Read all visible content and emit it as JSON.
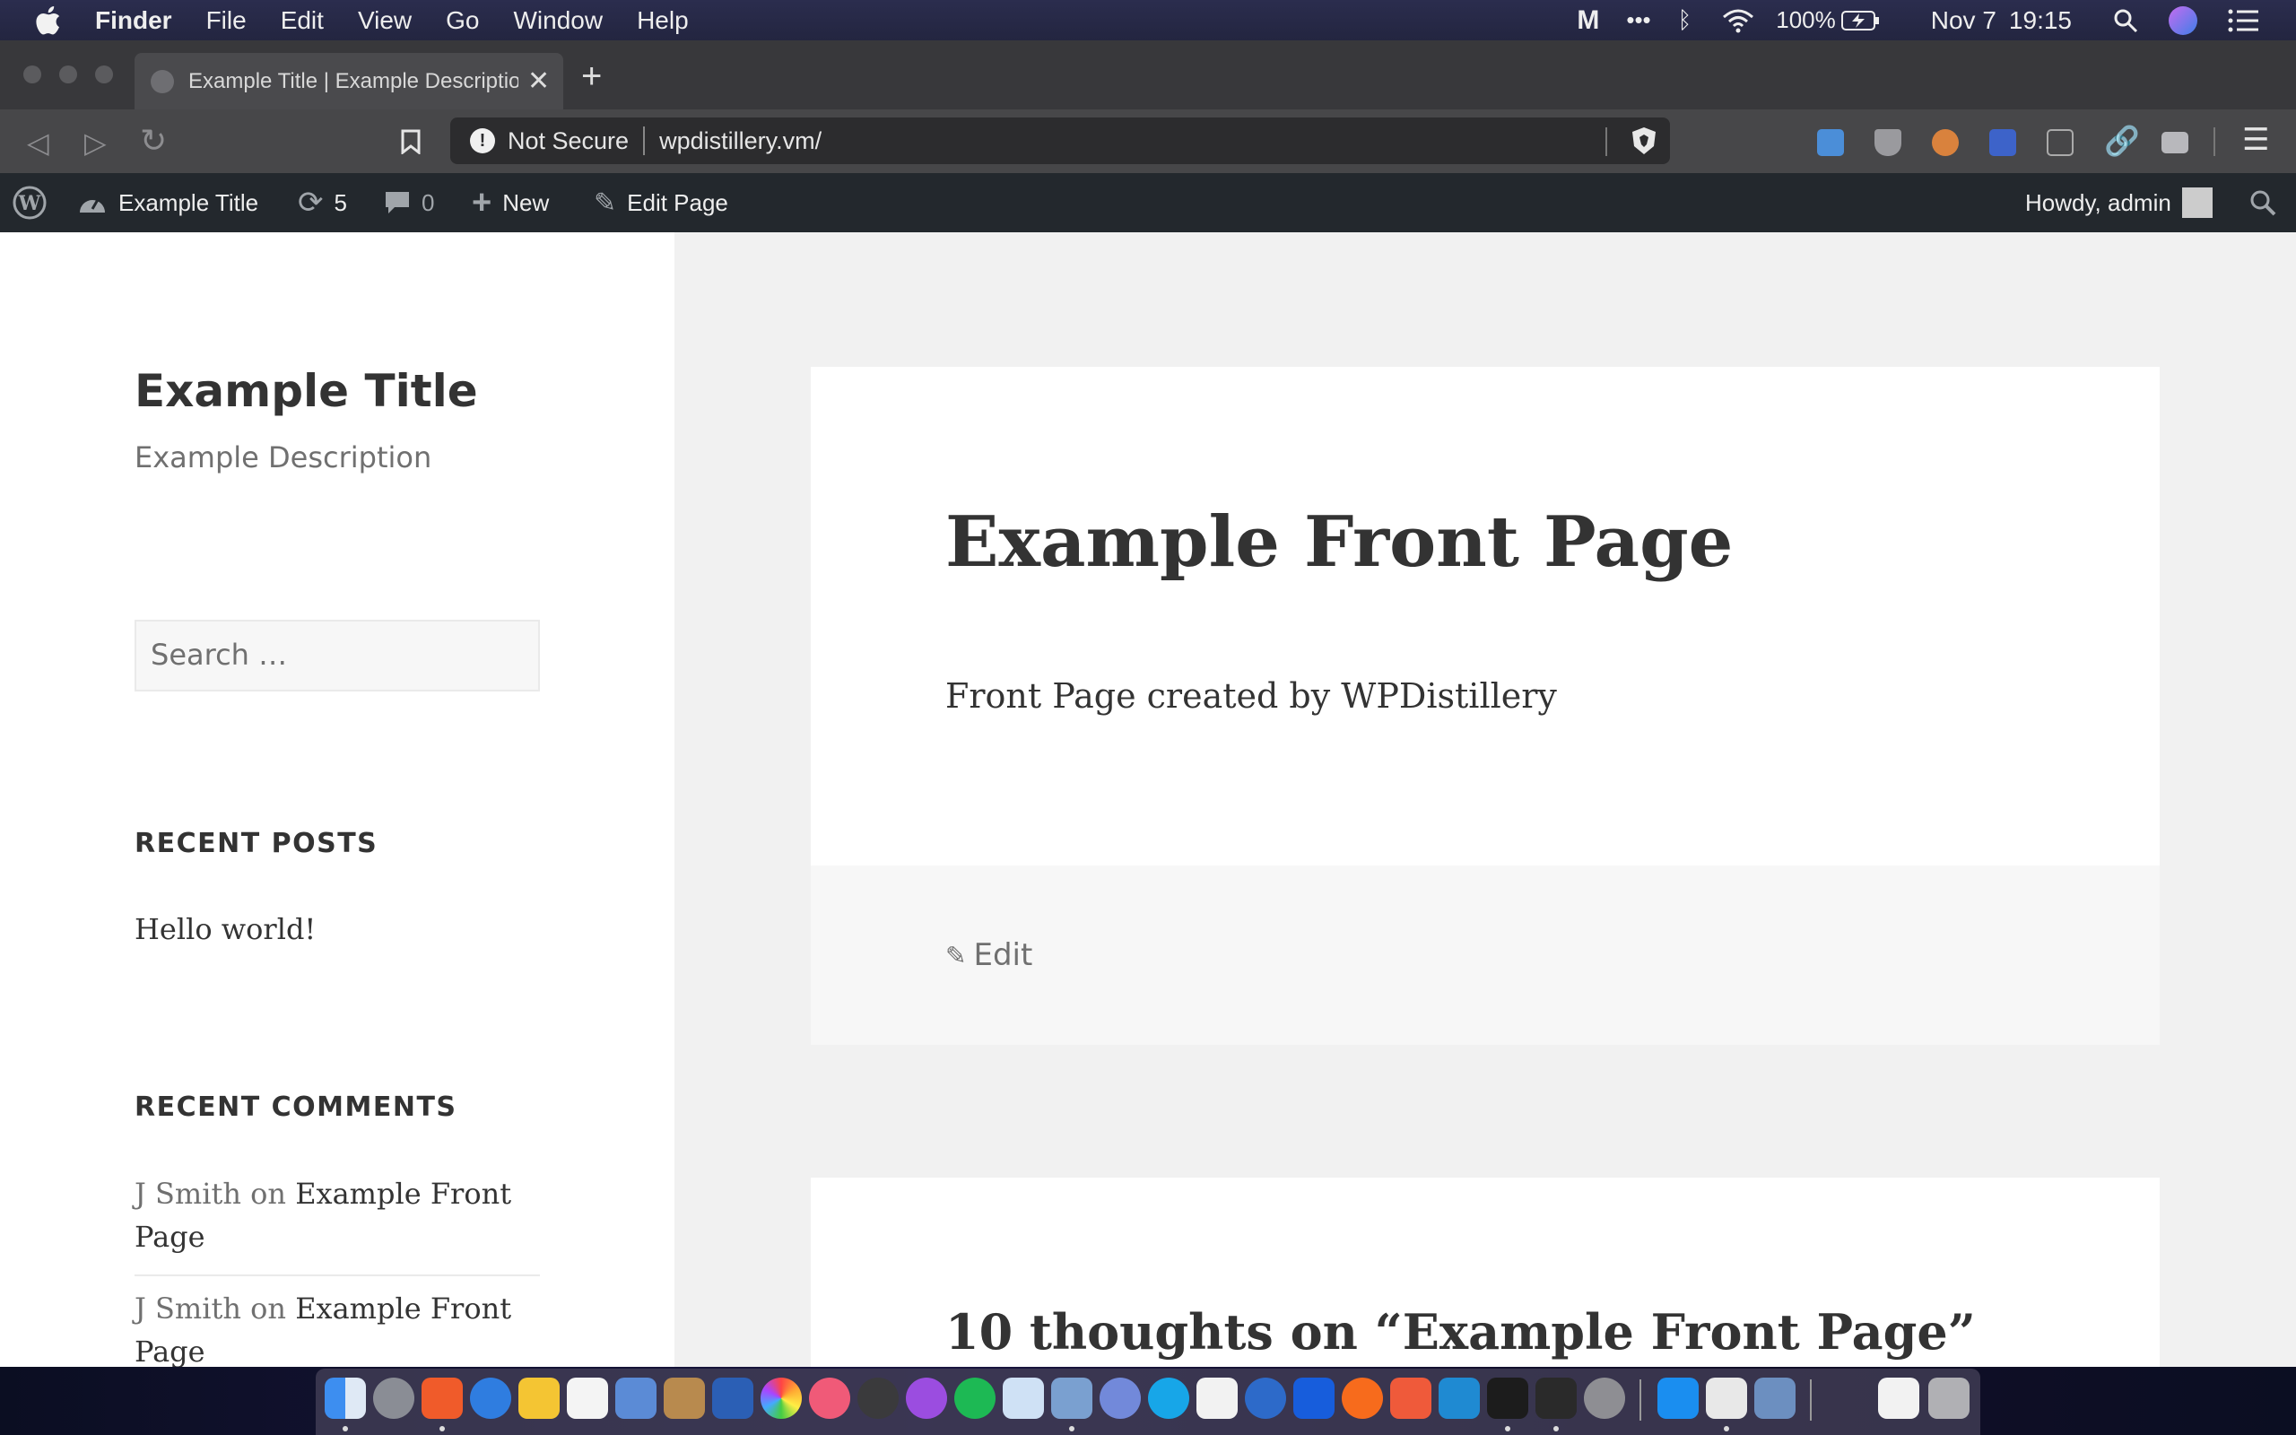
{
  "menubar": {
    "app": "Finder",
    "items": [
      "File",
      "Edit",
      "View",
      "Go",
      "Window",
      "Help"
    ],
    "battery": "100%",
    "date": "Nov 7",
    "time": "19:15"
  },
  "browser": {
    "tab_title": "Example Title | Example Description",
    "security": "Not Secure",
    "url": "wpdistillery.vm/"
  },
  "adminbar": {
    "site_name": "Example Title",
    "updates": "5",
    "comments": "0",
    "new": "New",
    "edit_page": "Edit Page",
    "howdy": "Howdy, admin"
  },
  "sidebar": {
    "site_title": "Example Title",
    "site_description": "Example Description",
    "search_placeholder": "Search …",
    "recent_posts_title": "RECENT POSTS",
    "recent_posts": [
      "Hello world!"
    ],
    "recent_comments_title": "RECENT COMMENTS",
    "recent_comments": [
      {
        "author": "J Smith",
        "on": "on",
        "post": "Example Front Page"
      },
      {
        "author": "J Smith",
        "on": "on",
        "post": "Example Front Page"
      }
    ]
  },
  "main": {
    "entry_title": "Example Front Page",
    "entry_body": "Front Page created by WPDistillery",
    "edit_label": "Edit",
    "comments_title": "10 thoughts on “Example Front Page”"
  },
  "colors": {
    "admin_bar": "#23282d",
    "content_bg": "#f1f1f1",
    "text": "#333333",
    "muted": "#707070"
  }
}
